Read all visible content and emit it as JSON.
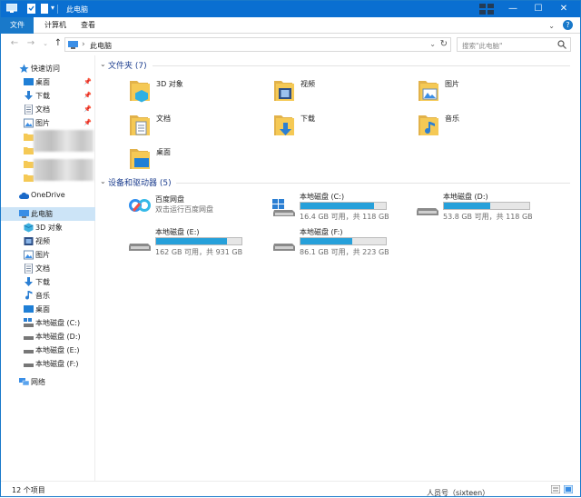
{
  "titlebar": {
    "title": "此电脑"
  },
  "ribbon": {
    "tabs": [
      "文件",
      "计算机",
      "查看"
    ]
  },
  "address": {
    "path": "此电脑",
    "search_placeholder": "搜索\"此电脑\""
  },
  "nav": {
    "quick_access": "快速访问",
    "quick_items": [
      "桌面",
      "下载",
      "文档",
      "图片"
    ],
    "onedrive": "OneDrive",
    "this_pc": "此电脑",
    "pc_items": [
      "3D 对象",
      "视频",
      "图片",
      "文档",
      "下载",
      "音乐",
      "桌面",
      "本地磁盘 (C:)",
      "本地磁盘 (D:)",
      "本地磁盘 (E:)",
      "本地磁盘 (F:)"
    ],
    "network": "网络"
  },
  "main": {
    "folders_header": "文件夹 (7)",
    "folders": [
      "3D 对象",
      "视频",
      "图片",
      "文档",
      "下载",
      "音乐",
      "桌面"
    ],
    "devices_header": "设备和驱动器 (5)",
    "baidu": {
      "name": "百度网盘",
      "sub": "双击运行百度网盘"
    },
    "drives": [
      {
        "name": "本地磁盘 (C:)",
        "space": "16.4 GB 可用，共 118 GB",
        "used_fraction": 0.86
      },
      {
        "name": "本地磁盘 (D:)",
        "space": "53.8 GB 可用，共 118 GB",
        "used_fraction": 0.54
      },
      {
        "name": "本地磁盘 (E:)",
        "space": "162 GB 可用，共 931 GB",
        "used_fraction": 0.83
      },
      {
        "name": "本地磁盘 (F:)",
        "space": "86.1 GB 可用，共 223 GB",
        "used_fraction": 0.61
      }
    ]
  },
  "status": {
    "items": "12 个项目"
  },
  "clipped_text": "人员号（sixteen）",
  "colors": {
    "accent": "#0a6fd1",
    "bar": "#26a0da",
    "selected": "#cce4f7",
    "folder": "#f5c955"
  }
}
